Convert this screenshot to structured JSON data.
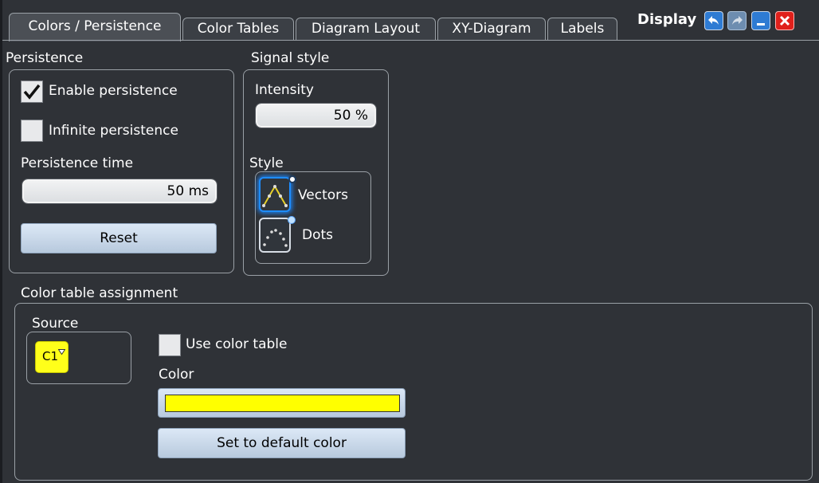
{
  "tabs": [
    {
      "label": "Colors / Persistence",
      "active": true
    },
    {
      "label": "Color Tables",
      "active": false
    },
    {
      "label": "Diagram Layout",
      "active": false
    },
    {
      "label": "XY-Diagram",
      "active": false
    },
    {
      "label": "Labels",
      "active": false
    }
  ],
  "window": {
    "title": "Display",
    "icons": [
      "undo-icon",
      "redo-icon",
      "minimize-icon",
      "close-icon"
    ]
  },
  "persistence": {
    "title": "Persistence",
    "enable_label": "Enable persistence",
    "enable_checked": true,
    "infinite_label": "Infinite persistence",
    "infinite_checked": false,
    "time_label": "Persistence time",
    "time_value": "50 ms",
    "reset_label": "Reset"
  },
  "signal_style": {
    "title": "Signal style",
    "intensity_label": "Intensity",
    "intensity_value": "50 %",
    "style_label": "Style",
    "options": [
      {
        "label": "Vectors",
        "selected": true,
        "icon": "vectors-icon"
      },
      {
        "label": "Dots",
        "selected": false,
        "icon": "dots-icon"
      }
    ]
  },
  "color_table_assignment": {
    "title": "Color table assignment",
    "source_label": "Source",
    "source_value": "C1",
    "source_color": "#ffff00",
    "use_table_label": "Use color table",
    "use_table_checked": false,
    "color_label": "Color",
    "color_value": "#ffff00",
    "default_button": "Set to default color"
  }
}
